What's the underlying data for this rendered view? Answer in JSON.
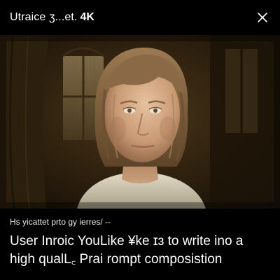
{
  "header": {
    "title": "Utraice ʒ...et.",
    "quality": "4K",
    "close_icon": "close-icon"
  },
  "video": {
    "subject": "portrait-frame",
    "palette": {
      "background": "#1a140c",
      "wall": "#3a2a14",
      "window": "#6b5a3a",
      "skin": "#d9b08c",
      "hair": "#8a6a48",
      "shirt": "#d8d2c0"
    }
  },
  "caption": {
    "meta": "Hs yicattet prto gy ierres/ --",
    "line1": "User Inroic YouLike ¥ke ɪɜ to write ino a",
    "line2": "high qualL꜀ Prai rompt composistion"
  }
}
